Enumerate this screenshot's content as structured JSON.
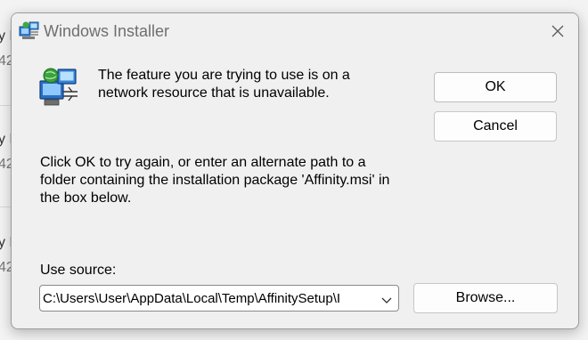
{
  "background": {
    "rows": [
      "y D",
      "42",
      "y P",
      "42",
      "y P",
      "42"
    ]
  },
  "dialog": {
    "title": "Windows Installer",
    "close_icon": "close-icon",
    "message": "The feature you are trying to use is on a network resource that is unavailable.",
    "instruction": "Click OK to try again, or enter an alternate path to a folder containing the installation package 'Affinity.msi' in the box below.",
    "use_source_label": "Use source:",
    "source_value": "C:\\Users\\User\\AppData\\Local\\Temp\\AffinitySetup\\I",
    "buttons": {
      "ok": "OK",
      "cancel": "Cancel",
      "browse": "Browse..."
    }
  },
  "colors": {
    "dialog_bg": "#f0f0f0",
    "title_text": "#6f6f6f",
    "button_bg": "#fdfdfd"
  }
}
